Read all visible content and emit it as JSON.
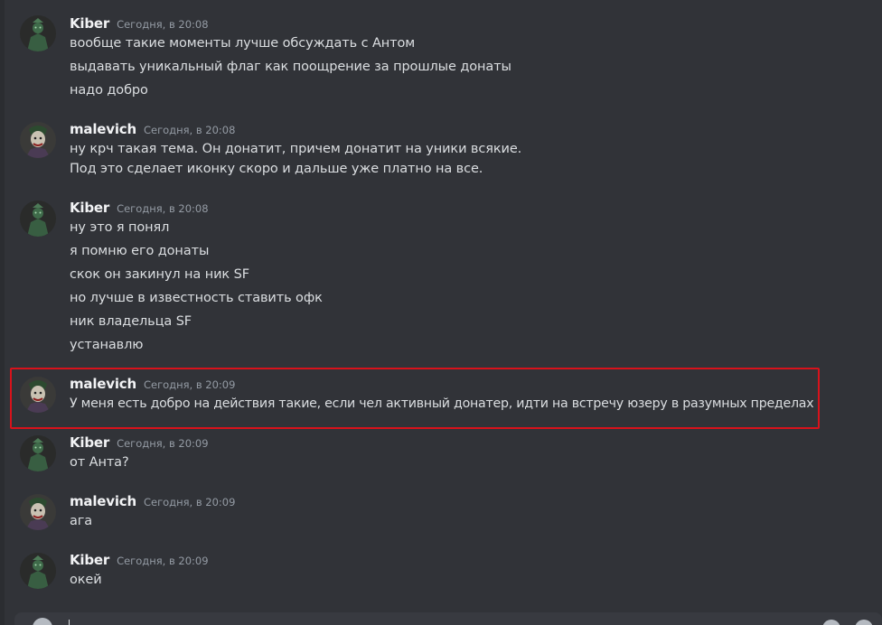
{
  "messages": [
    {
      "author": "Kiber",
      "avatar_icon": "green-figure-avatar",
      "timestamp": "Сегодня, в 20:08",
      "lines": [
        "вообще такие моменты лучше обсуждать с Антом",
        "выдавать уникальный флаг как поощрение за прошлые донаты",
        "надо добро"
      ]
    },
    {
      "author": "malevich",
      "avatar_icon": "joker-avatar",
      "timestamp": "Сегодня, в 20:08",
      "lines": [
        "ну крч такая тема. Он донатит, причем донатит на уники всякие.",
        "Под это сделает иконку скоро и дальше уже платно на все."
      ]
    },
    {
      "author": "Kiber",
      "avatar_icon": "green-figure-avatar",
      "timestamp": "Сегодня, в 20:08",
      "lines": [
        "ну это я понял",
        "я помню его донаты",
        "скок он закинул на ник SF",
        "но лучше в известность ставить офк",
        "ник владельца SF",
        "устанавлю"
      ]
    },
    {
      "author": "malevich",
      "avatar_icon": "joker-avatar",
      "timestamp": "Сегодня, в 20:09",
      "highlighted": true,
      "lines": [
        "У меня есть добро на действия такие, если чел активный донатер, идти на встречу юзеру в разумных пределах"
      ]
    },
    {
      "author": "Kiber",
      "avatar_icon": "green-figure-avatar",
      "timestamp": "Сегодня, в 20:09",
      "lines": [
        "от Анта?"
      ]
    },
    {
      "author": "malevich",
      "avatar_icon": "joker-avatar",
      "timestamp": "Сегодня, в 20:09",
      "lines": [
        "ага"
      ]
    },
    {
      "author": "Kiber",
      "avatar_icon": "green-figure-avatar",
      "timestamp": "Сегодня, в 20:09",
      "lines": [
        "окей"
      ]
    }
  ],
  "colors": {
    "background": "#313338",
    "author": "#f2f3f5",
    "text": "#dbdee1",
    "timestamp": "#949ba4",
    "highlight_border": "#d8121b"
  }
}
